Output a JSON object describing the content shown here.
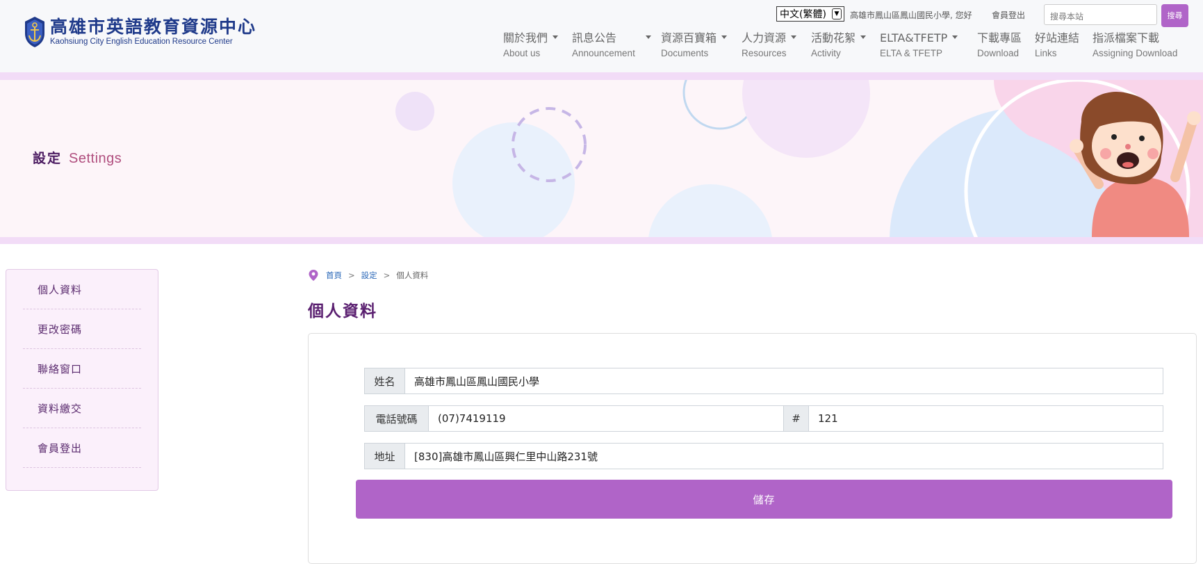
{
  "header": {
    "logo_zh": "高雄市英語教育資源中心",
    "logo_en": "Kaohsiung City English Education Resource Center",
    "language": "中文(繁體)",
    "greeting": "高雄市鳳山區鳳山國民小學, 您好",
    "logout": "會員登出",
    "search_placeholder": "搜尋本站",
    "search_button": "搜尋"
  },
  "nav": [
    {
      "zh": "關於我們",
      "en": "About us"
    },
    {
      "zh": "訊息公告",
      "en": "Announcement"
    },
    {
      "zh": "資源百寶箱",
      "en": "Documents"
    },
    {
      "zh": "人力資源",
      "en": "Resources"
    },
    {
      "zh": "活動花絮",
      "en": "Activity"
    },
    {
      "zh": "ELTA&TFETP",
      "en": "ELTA & TFETP"
    },
    {
      "zh": "下載專區",
      "en": "Download"
    },
    {
      "zh": "好站連結",
      "en": "Links"
    },
    {
      "zh": "指派檔案下載",
      "en": "Assigning Download"
    }
  ],
  "banner": {
    "title_zh": "設定",
    "title_en": "Settings"
  },
  "sidebar": {
    "items": [
      {
        "label": "個人資料"
      },
      {
        "label": "更改密碼"
      },
      {
        "label": "聯絡窗口"
      },
      {
        "label": "資料繳交"
      },
      {
        "label": "會員登出"
      }
    ]
  },
  "breadcrumb": {
    "home": "首頁",
    "sep": ">",
    "settings": "設定",
    "current": "個人資料"
  },
  "main": {
    "title": "個人資料",
    "name_label": "姓名",
    "name_value": "高雄市鳳山區鳳山國民小學",
    "phone_label": "電話號碼",
    "phone_value": "(07)7419119",
    "ext_label": "#",
    "ext_value": "121",
    "address_label": "地址",
    "address_value": "[830]高雄市鳳山區興仁里中山路231號",
    "save_label": "儲存"
  },
  "colors": {
    "accent": "#b064c8",
    "title": "#5a1f70",
    "logo": "#1f3a8a"
  }
}
